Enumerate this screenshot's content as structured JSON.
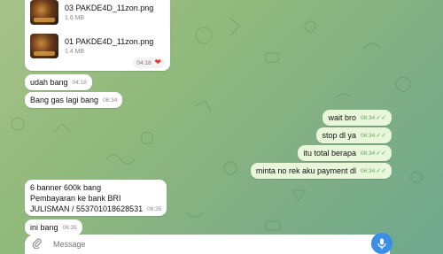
{
  "files": [
    {
      "name": "03 PAKDE4D_11zon.png",
      "size": "1.6 MB"
    },
    {
      "name": "01 PAKDE4D_11zon.png",
      "size": "1.4 MB",
      "time": "04:18"
    }
  ],
  "incoming": [
    {
      "text": "udah bang",
      "time": "04:18"
    },
    {
      "text": "Bang gas lagi bang",
      "time": "06:34"
    }
  ],
  "outgoing": [
    {
      "text": "wait bro",
      "time": "06:34"
    },
    {
      "text": "stop dl ya",
      "time": "06:34"
    },
    {
      "text": "itu total berapa",
      "time": "06:34"
    },
    {
      "text": "minta no rek aku payment dl",
      "time": "06:34"
    }
  ],
  "payment_message": {
    "line1": "6 banner 600k bang",
    "line2": "Pembayaran ke bank BRI",
    "line3": "JULISMAN / 553701018628531",
    "time": "06:35"
  },
  "last_incoming": {
    "text": "ini bang",
    "time": "06:35"
  },
  "composer": {
    "placeholder": "Message"
  },
  "icons": {
    "attach": "paperclip-icon",
    "emoji": "emoji-icon",
    "mic": "microphone-icon",
    "read": "double-check-icon",
    "reaction": "heart-icon"
  },
  "colors": {
    "incoming_bubble": "#ffffff",
    "outgoing_bubble": "#e8f6d9",
    "mic_button": "#3a8ee6",
    "reaction_heart": "#e53935"
  }
}
